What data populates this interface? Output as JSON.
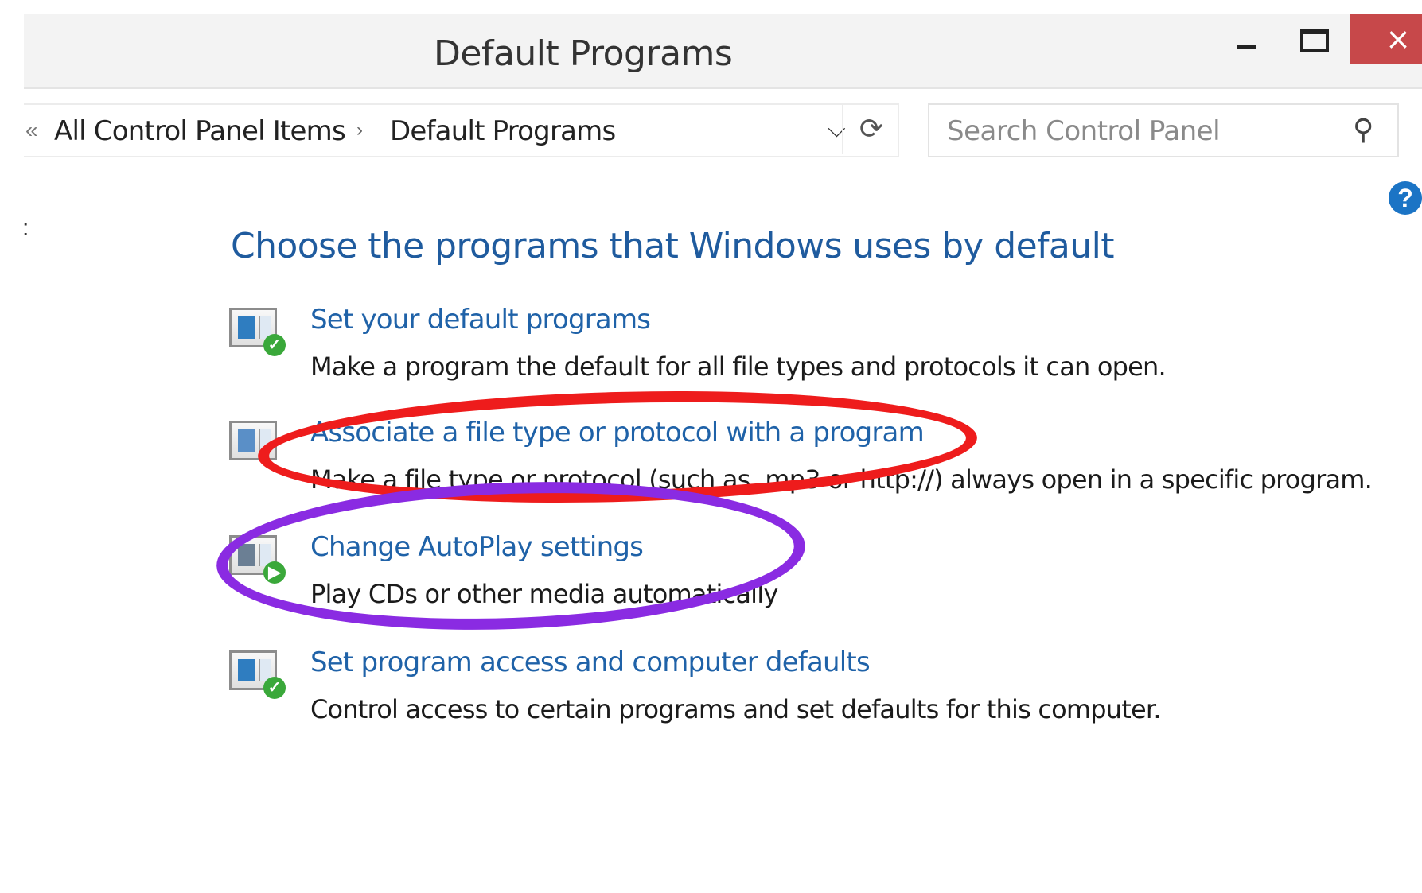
{
  "window": {
    "title": "Default Programs",
    "close_glyph": "×"
  },
  "address_bar": {
    "back_glyph": "«",
    "breadcrumb": [
      "All Control Panel Items",
      "Default Programs"
    ],
    "separator_glyph": "›",
    "dropdown_glyph": "⌵",
    "refresh_glyph": "⟳"
  },
  "search": {
    "placeholder": "Search Control Panel",
    "icon": "search-icon",
    "glyph": "⚲"
  },
  "help": {
    "glyph": "?"
  },
  "nav_stub": ":",
  "main": {
    "heading": "Choose the programs that Windows uses by default",
    "options": [
      {
        "link": "Set your default programs",
        "description": "Make a program the default for all file types and protocols it can open.",
        "icon": "default-programs-icon"
      },
      {
        "link": "Associate a file type or protocol with a program",
        "description": "Make a file type or protocol (such as .mp3 or http://) always open in a specific program.",
        "icon": "file-association-icon"
      },
      {
        "link": "Change AutoPlay settings",
        "description": "Play CDs or other media automatically",
        "icon": "autoplay-icon"
      },
      {
        "link": "Set program access and computer defaults",
        "description": "Control access to certain programs and set defaults for this computer.",
        "icon": "program-access-icon"
      }
    ]
  },
  "colors": {
    "link": "#1f62a8",
    "heading": "#1f5b9e",
    "close_button": "#c7484a",
    "annotation_red": "#ee1c1c",
    "annotation_purple": "#8a2be2"
  }
}
